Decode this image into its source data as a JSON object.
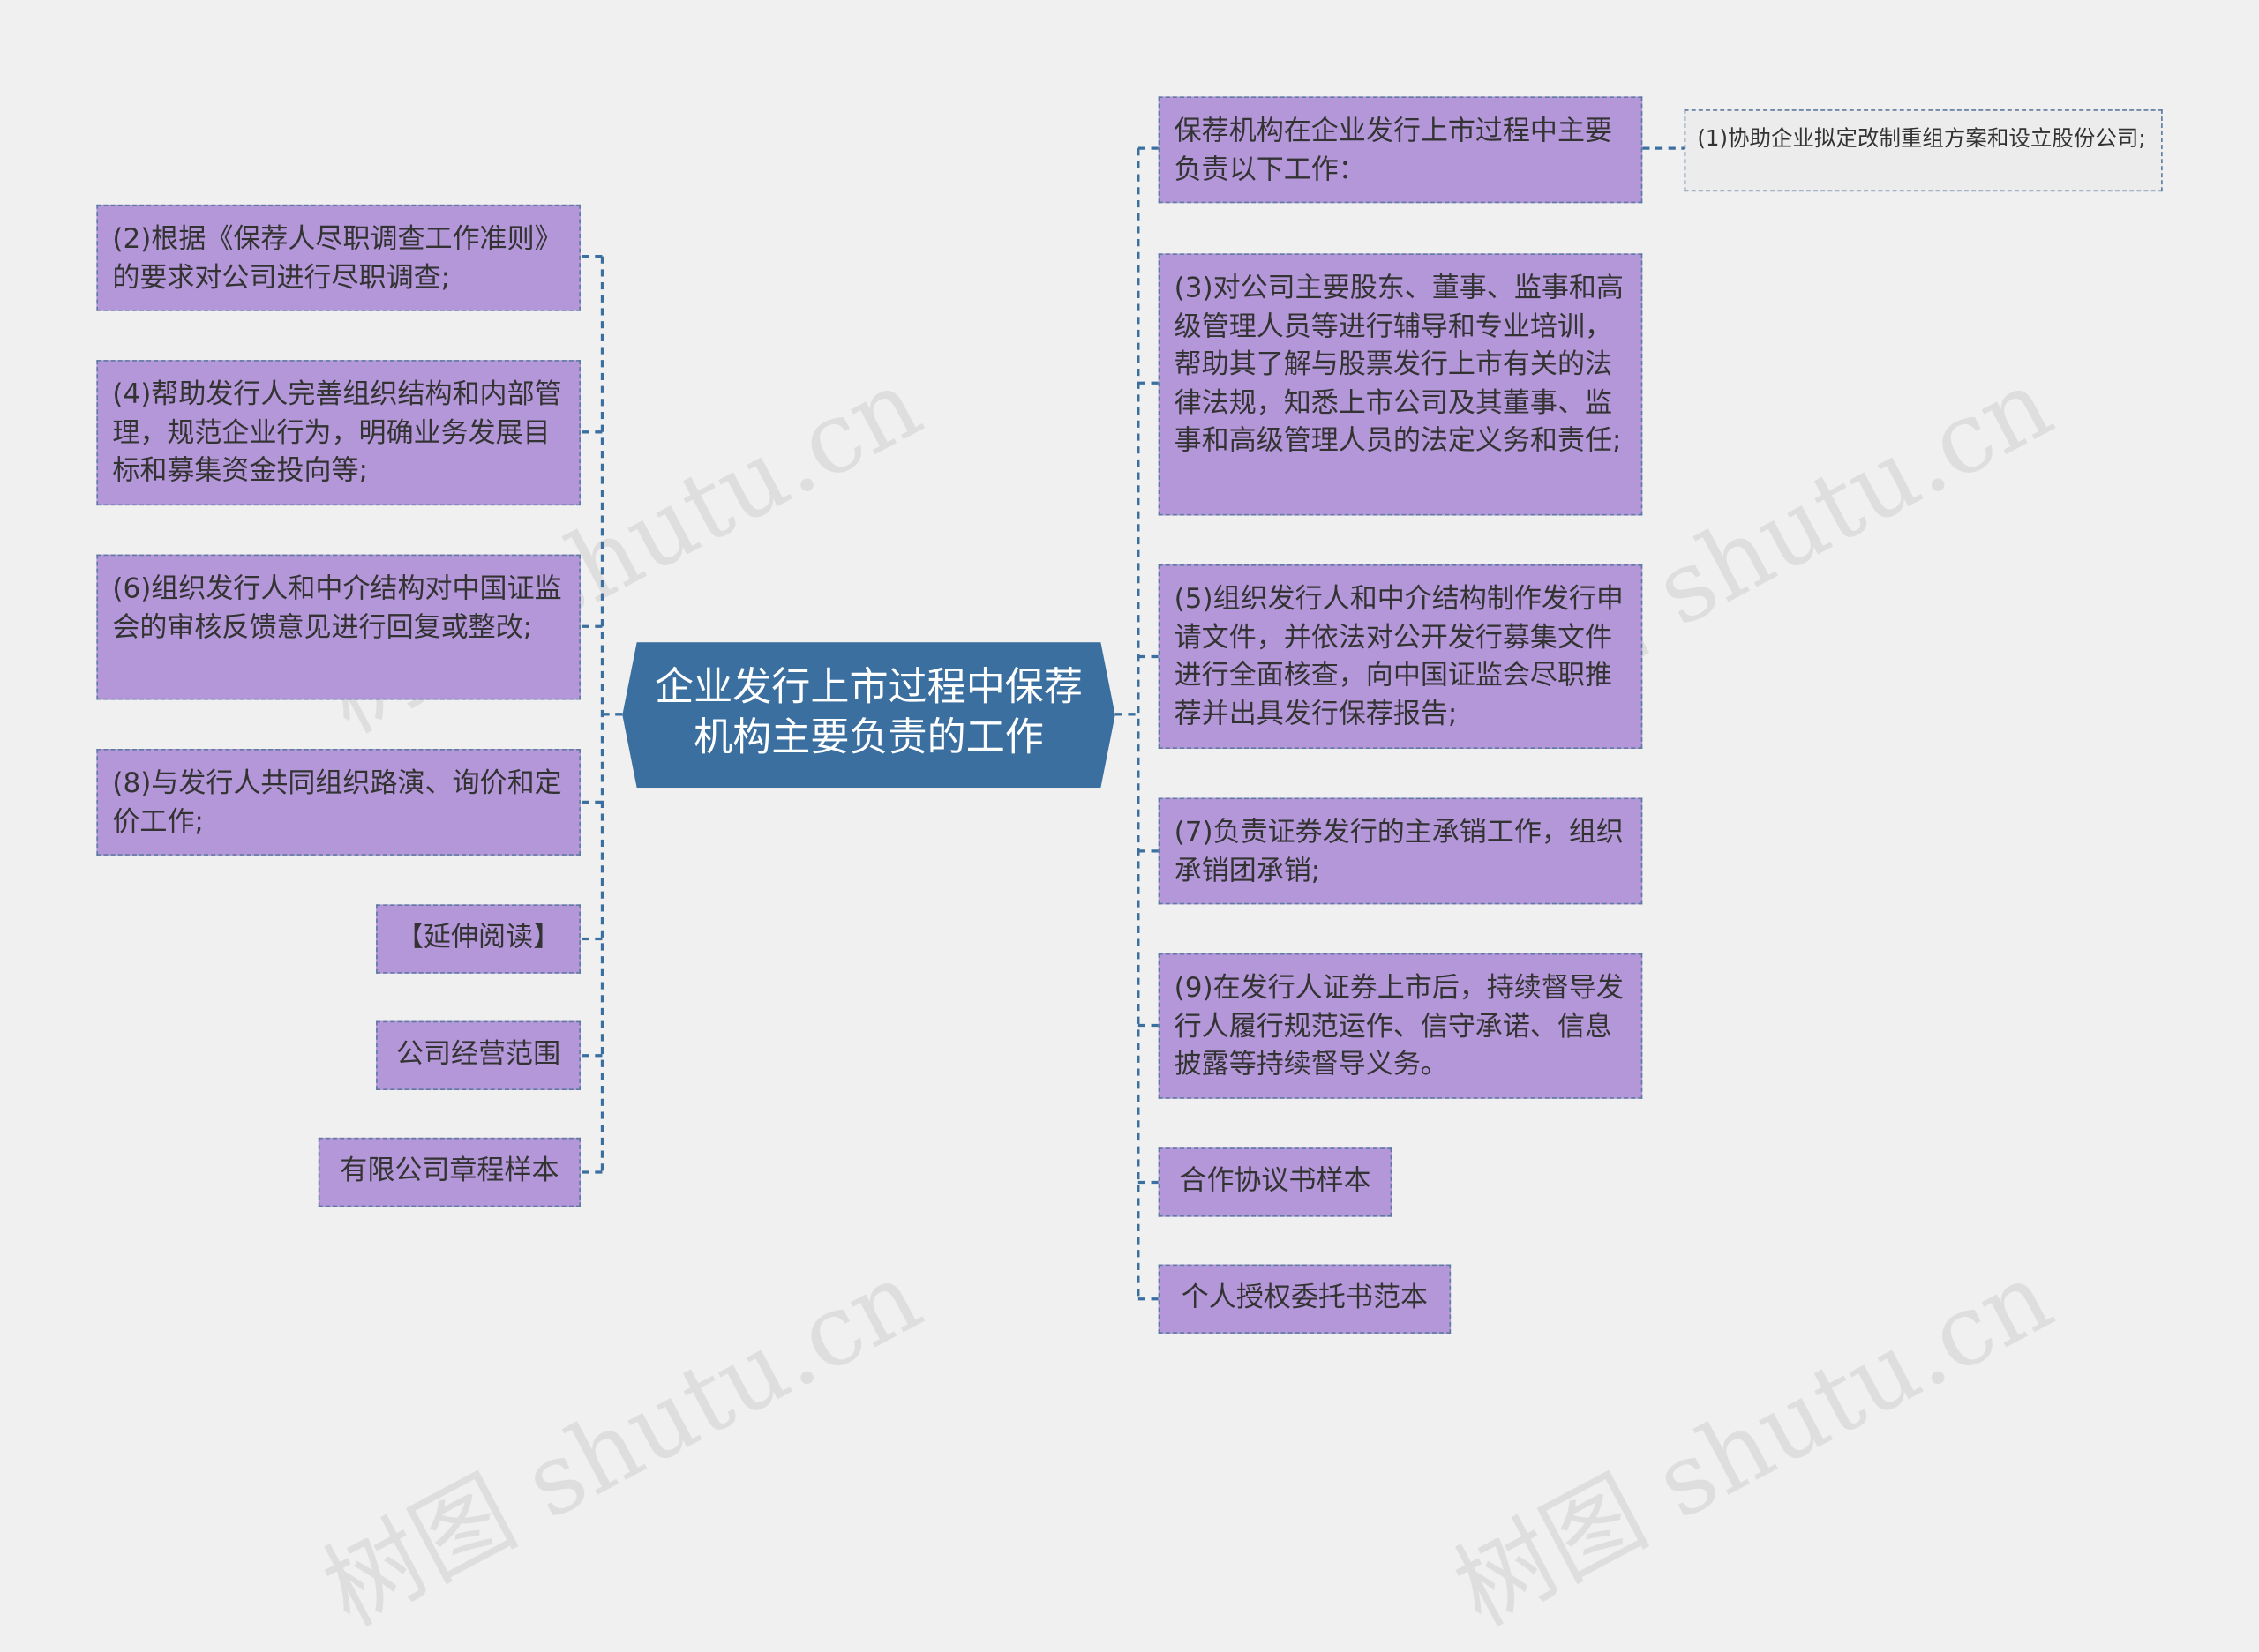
{
  "center": {
    "title": "企业发行上市过程中保荐机构主要负责的工作",
    "color": "#3a6fa0"
  },
  "node_color": "#b497d9",
  "connector_color": "#3a6fa0",
  "watermark": "树图 shutu.cn",
  "left_nodes": [
    "(2)根据《保荐人尽职调查工作准则》的要求对公司进行尽职调查;",
    "(4)帮助发行人完善组织结构和内部管理，规范企业行为，明确业务发展目标和募集资金投向等;",
    "(6)组织发行人和中介结构对中国证监会的审核反馈意见进行回复或整改;",
    "(8)与发行人共同组织路演、询价和定价工作;",
    "【延伸阅读】",
    "公司经营范围",
    "有限公司章程样本"
  ],
  "right_nodes": [
    "保荐机构在企业发行上市过程中主要负责以下工作：",
    "(3)对公司主要股东、董事、监事和高级管理人员等进行辅导和专业培训，帮助其了解与股票发行上市有关的法律法规，知悉上市公司及其董事、监事和高级管理人员的法定义务和责任;",
    "(5)组织发行人和中介结构制作发行申请文件，并依法对公开发行募集文件进行全面核查，向中国证监会尽职推荐并出具发行保荐报告;",
    "(7)负责证券发行的主承销工作，组织承销团承销;",
    "(9)在发行人证券上市后，持续督导发行人履行规范运作、信守承诺、信息披露等持续督导义务。",
    "合作协议书样本",
    "个人授权委托书范本"
  ],
  "leaf_node": "(1)协助企业拟定改制重组方案和设立股份公司;"
}
